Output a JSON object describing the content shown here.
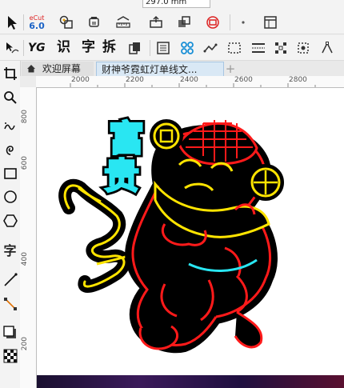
{
  "topbar": {
    "field_value": "297.0 mm"
  },
  "toolbar2": {
    "ecut_logo": {
      "line1": "eCut",
      "line2": "6.0"
    }
  },
  "toolbar3": {
    "yg_label": "YG",
    "recognize_label": "识",
    "char_label": "字",
    "split_label": "拆"
  },
  "tabs": {
    "welcome": "欢迎屏幕",
    "document": "财神爷霓虹灯单线文...",
    "add": "+"
  },
  "lefttools": {
    "text_tool_label": "字"
  },
  "ruler_top": {
    "labels": [
      "2000",
      "2200",
      "2400",
      "2600",
      "2800"
    ]
  },
  "ruler_left": {
    "labels": [
      "800",
      "600",
      "400",
      "200"
    ]
  },
  "artwork": {
    "calligraphy": {
      "char1": "富",
      "char2": "贵"
    },
    "colors": {
      "red": "#ff1a1a",
      "yellow": "#ffe400",
      "cyan": "#29e6f2",
      "black": "#000000"
    }
  }
}
